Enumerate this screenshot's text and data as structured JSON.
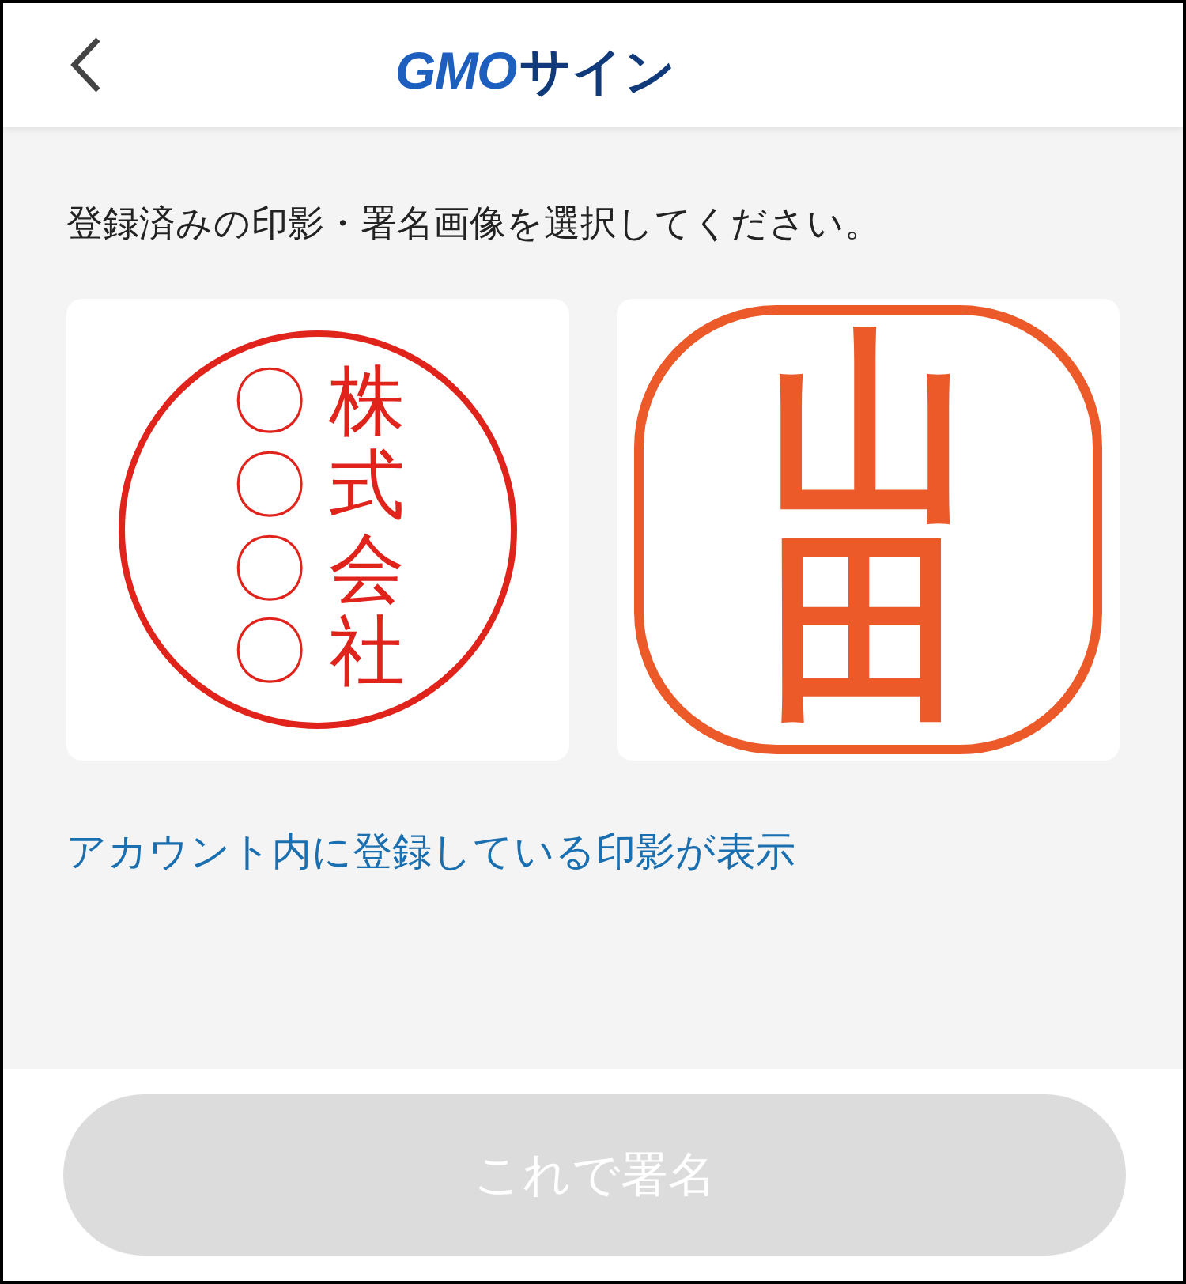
{
  "header": {
    "logo": {
      "brand": "GMO",
      "product": "サイン"
    }
  },
  "instruction": "登録済みの印影・署名画像を選択してください。",
  "seals": [
    {
      "kind": "round",
      "columns": [
        "〇〇〇〇",
        "株式会社"
      ]
    },
    {
      "kind": "square",
      "columns": [
        "山田"
      ]
    }
  ],
  "note": "アカウント内に登録している印影が表示",
  "sign_button": {
    "label": "これで署名",
    "disabled": true
  }
}
